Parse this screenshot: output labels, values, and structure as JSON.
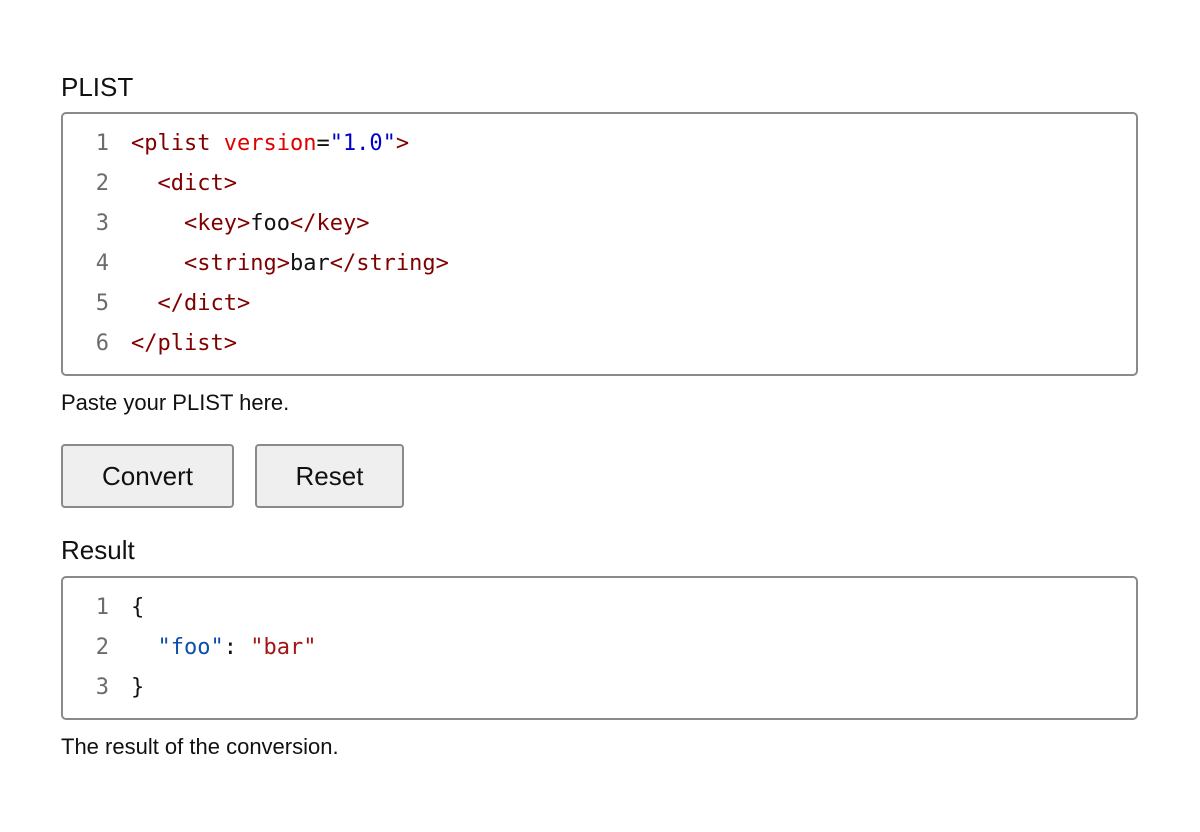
{
  "input": {
    "label": "PLIST",
    "hint": "Paste your PLIST here.",
    "lines": [
      {
        "num": "1",
        "indent": "",
        "parts": [
          {
            "cls": "tag",
            "text": "<plist "
          },
          {
            "cls": "attr",
            "text": "version"
          },
          {
            "cls": "plain",
            "text": "="
          },
          {
            "cls": "aval",
            "text": "\"1.0\""
          },
          {
            "cls": "tag",
            "text": ">"
          }
        ]
      },
      {
        "num": "2",
        "indent": "  ",
        "parts": [
          {
            "cls": "tag",
            "text": "<dict>"
          }
        ]
      },
      {
        "num": "3",
        "indent": "    ",
        "parts": [
          {
            "cls": "tag",
            "text": "<key>"
          },
          {
            "cls": "plain",
            "text": "foo"
          },
          {
            "cls": "tag",
            "text": "</key>"
          }
        ]
      },
      {
        "num": "4",
        "indent": "    ",
        "parts": [
          {
            "cls": "tag",
            "text": "<string>"
          },
          {
            "cls": "plain",
            "text": "bar"
          },
          {
            "cls": "tag",
            "text": "</string>"
          }
        ]
      },
      {
        "num": "5",
        "indent": "  ",
        "parts": [
          {
            "cls": "tag",
            "text": "</dict>"
          }
        ]
      },
      {
        "num": "6",
        "indent": "",
        "parts": [
          {
            "cls": "tag",
            "text": "</plist>"
          }
        ]
      }
    ]
  },
  "buttons": {
    "convert": "Convert",
    "reset": "Reset"
  },
  "output": {
    "label": "Result",
    "hint": "The result of the conversion.",
    "lines": [
      {
        "num": "1",
        "indent": "",
        "parts": [
          {
            "cls": "plain",
            "text": "{"
          }
        ]
      },
      {
        "num": "2",
        "indent": "  ",
        "parts": [
          {
            "cls": "jkey",
            "text": "\"foo\""
          },
          {
            "cls": "plain",
            "text": ": "
          },
          {
            "cls": "jstr",
            "text": "\"bar\""
          }
        ]
      },
      {
        "num": "3",
        "indent": "",
        "parts": [
          {
            "cls": "plain",
            "text": "}"
          }
        ]
      }
    ]
  }
}
